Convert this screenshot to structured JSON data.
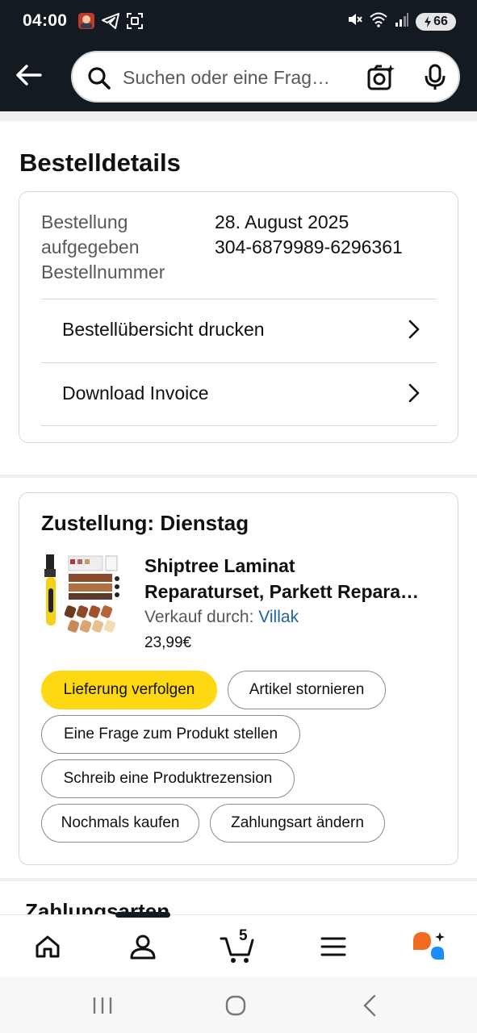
{
  "status_bar": {
    "time": "04:00",
    "battery": "66",
    "icons_left": [
      "avatar-notification-icon",
      "telegram-icon",
      "screenshot-icon"
    ],
    "icons_right": [
      "mute-icon",
      "wifi-icon",
      "signal-icon",
      "battery-icon"
    ]
  },
  "header": {
    "search_placeholder": "Suchen oder eine Frag…",
    "icons": [
      "back-arrow-icon",
      "search-icon",
      "camera-lens-icon",
      "mic-icon"
    ]
  },
  "page": {
    "title": "Bestelldetails"
  },
  "order": {
    "label_placed": "Bestellung aufgegeben",
    "label_placed_line1": "Bestellung",
    "label_placed_line2": "aufgegeben",
    "label_number": "Bestellnummer",
    "date": "28. August 2025",
    "number": "304-6879989-6296361",
    "links": [
      {
        "label": "Bestellübersicht drucken"
      },
      {
        "label": "Download Invoice"
      }
    ]
  },
  "delivery": {
    "title": "Zustellung: Dienstag",
    "product": {
      "title_line1": "Shiptree Laminat",
      "title_line2": "Reparaturset, Parkett Repara…",
      "seller_prefix": "Verkauf durch:",
      "seller_name": "Villak",
      "price": "23,99€"
    },
    "buttons": [
      {
        "label": "Lieferung verfolgen"
      },
      {
        "label": "Artikel stornieren"
      },
      {
        "label": "Eine Frage zum Produkt stellen"
      },
      {
        "label": "Schreib eine Produktrezension"
      },
      {
        "label": "Nochmals kaufen"
      },
      {
        "label": "Zahlungsart ändern"
      }
    ]
  },
  "payment": {
    "title": "Zahlungsarten"
  },
  "bottom_nav": {
    "cart_count": "5",
    "items": [
      "home-icon",
      "account-icon",
      "cart-icon",
      "menu-icon",
      "rufus-ai-icon"
    ]
  },
  "colors": {
    "header_bg": "#131a22",
    "primary_button": "#ffd814",
    "link": "#2162a1"
  }
}
